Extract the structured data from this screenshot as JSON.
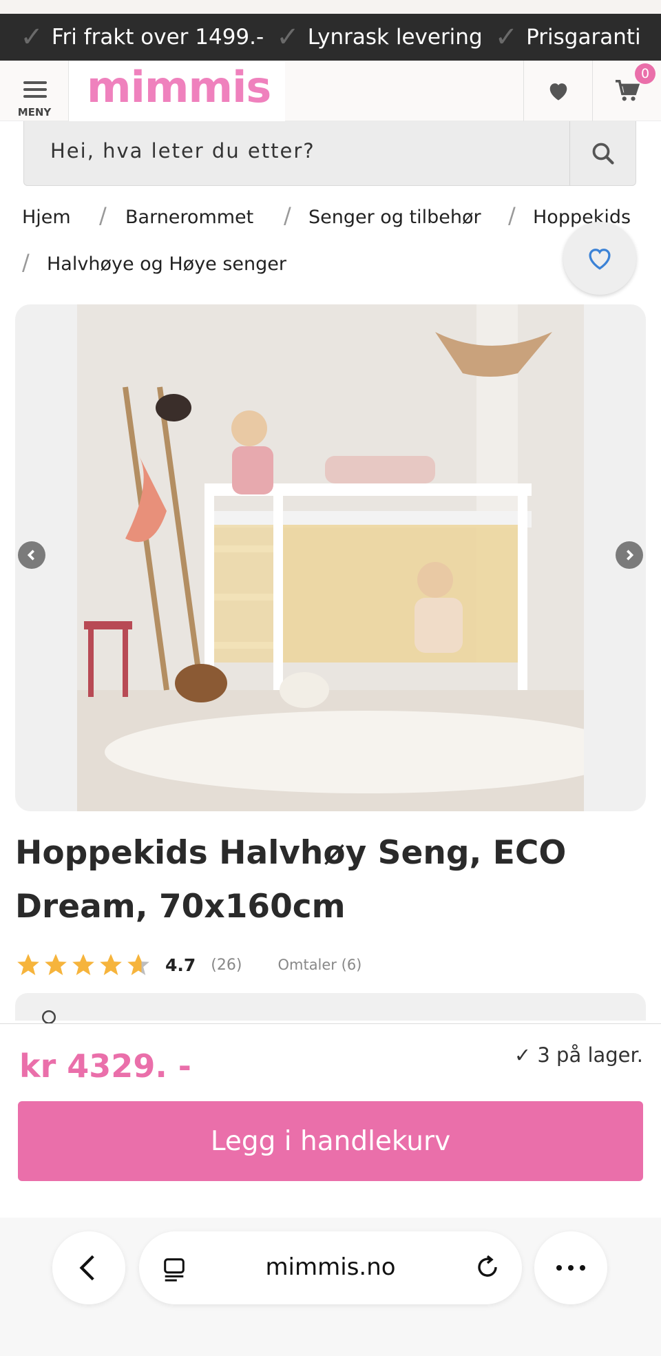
{
  "promo_bar": {
    "items": [
      "Fri frakt over 1499.-",
      "Lynrask levering",
      "Prisgaranti"
    ]
  },
  "header": {
    "menu_label": "MENY",
    "logo_text": "mimmis",
    "cart_count": "0",
    "brand_color": "#ef81bd"
  },
  "search": {
    "placeholder": "Hei, hva leter du etter?"
  },
  "breadcrumbs": [
    "Hjem",
    "Barnerommet",
    "Senger og tilbehør",
    "Hoppekids",
    "Halvhøye og Høye senger"
  ],
  "gallery": {
    "image_description_icon": "product-photo"
  },
  "product": {
    "title": "Hoppekids Halvhøy Seng, ECO Dream, 70x160cm",
    "rating": "4.7",
    "rating_count": "(26)",
    "reviews_link": "Omtaler (6)",
    "stars": 4.7
  },
  "purchase": {
    "price": "kr 4329. -",
    "stock": "✓ 3 på lager.",
    "add_to_cart": "Legg i handlekurv",
    "accent_color": "#ea6faa"
  },
  "browser": {
    "url": "mimmis.no"
  }
}
